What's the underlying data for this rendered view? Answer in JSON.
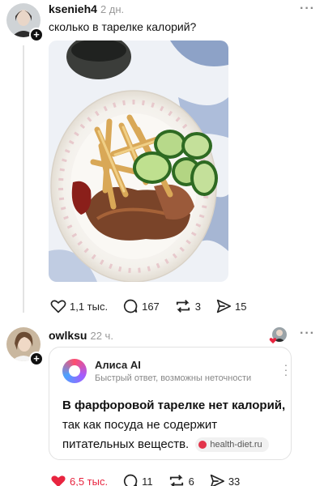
{
  "post": {
    "username": "ksenieh4",
    "time": "2 дн.",
    "text": "сколько в тарелке калорий?",
    "actions": {
      "likes": "1,1 тыс.",
      "comments": "167",
      "reposts": "3",
      "shares": "15"
    }
  },
  "reply": {
    "username": "owlksu",
    "time": "22 ч.",
    "alice": {
      "name": "Алиса AI",
      "subtitle": "Быстрый ответ, возможны неточности",
      "answer_bold": "В фарфоровой тарелке нет калорий,",
      "answer_rest": "так как посуда не содержит питательных веществ.",
      "source": "health-diet.ru"
    },
    "actions": {
      "likes": "6,5 тыс.",
      "comments": "11",
      "reposts": "6",
      "shares": "33"
    }
  },
  "colors": {
    "like_active": "#e8243f",
    "muted_text": "#999999",
    "thread_line": "#e3e3e3"
  }
}
